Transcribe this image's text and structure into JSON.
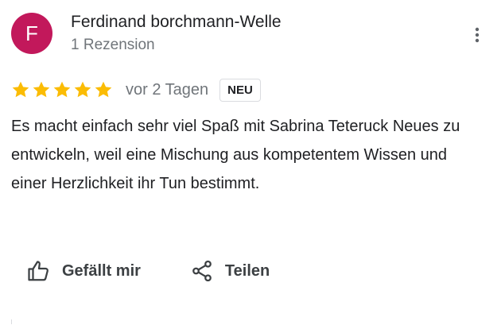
{
  "reviewer": {
    "initial": "F",
    "avatar_color": "#c2185b",
    "name": "Ferdinand borchmann-Welle",
    "review_count": "1 Rezension"
  },
  "more_menu": {
    "icon": "more-vert-icon"
  },
  "rating": {
    "value": 5,
    "max": 5,
    "star_color": "#fbbc04"
  },
  "date": "vor 2 Tagen",
  "badge": "NEU",
  "review_text": "Es macht einfach sehr viel Spaß mit Sabrina Teteruck Neues zu entwickeln, weil eine Mischung aus kompetentem Wissen und einer Herzlichkeit ihr Tun bestimmt.",
  "actions": {
    "like": {
      "label": "Gefällt mir",
      "icon": "thumbs-up-icon"
    },
    "share": {
      "label": "Teilen",
      "icon": "share-icon"
    }
  }
}
